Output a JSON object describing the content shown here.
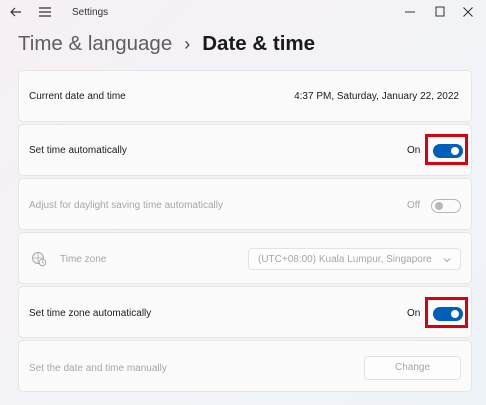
{
  "window": {
    "title": "Settings"
  },
  "breadcrumb": {
    "parent": "Time & language",
    "separator": "›",
    "current": "Date & time"
  },
  "current_datetime": {
    "label": "Current date and time",
    "value": "4:37 PM, Saturday, January 22, 2022"
  },
  "set_time_auto": {
    "label": "Set time automatically",
    "state": "On",
    "enabled": true
  },
  "daylight_saving": {
    "label": "Adjust for daylight saving time automatically",
    "state": "Off",
    "enabled": false
  },
  "time_zone": {
    "label": "Time zone",
    "selected": "(UTC+08:00) Kuala Lumpur, Singapore"
  },
  "set_tz_auto": {
    "label": "Set time zone automatically",
    "state": "On",
    "enabled": true
  },
  "manual": {
    "label": "Set the date and time manually",
    "button": "Change"
  },
  "colors": {
    "accent": "#005fb8",
    "highlight": "#d90010"
  },
  "icons": [
    "back-arrow-icon",
    "hamburger-menu-icon",
    "minimize-icon",
    "maximize-icon",
    "close-icon",
    "time-zone-globe-icon",
    "chevron-down-icon"
  ]
}
